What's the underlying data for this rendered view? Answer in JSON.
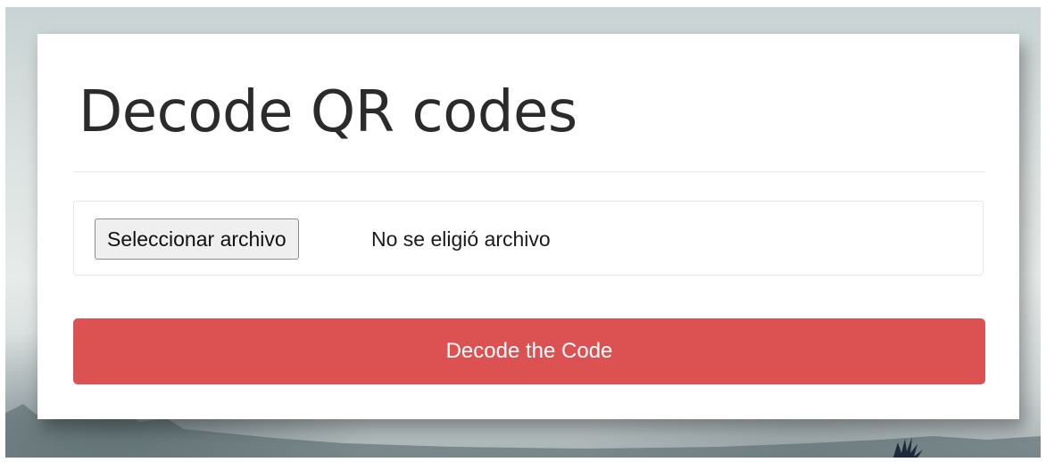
{
  "page": {
    "title": "Decode QR codes"
  },
  "file_input": {
    "button_label": "Seleccionar archivo",
    "status_text": "No se eligió archivo"
  },
  "submit": {
    "label": "Decode the Code"
  },
  "colors": {
    "submit_button": "#dc5152",
    "title_text": "#2b2b2b",
    "card_background": "#ffffff"
  },
  "icons": {
    "background_bird": "bird-icon"
  }
}
